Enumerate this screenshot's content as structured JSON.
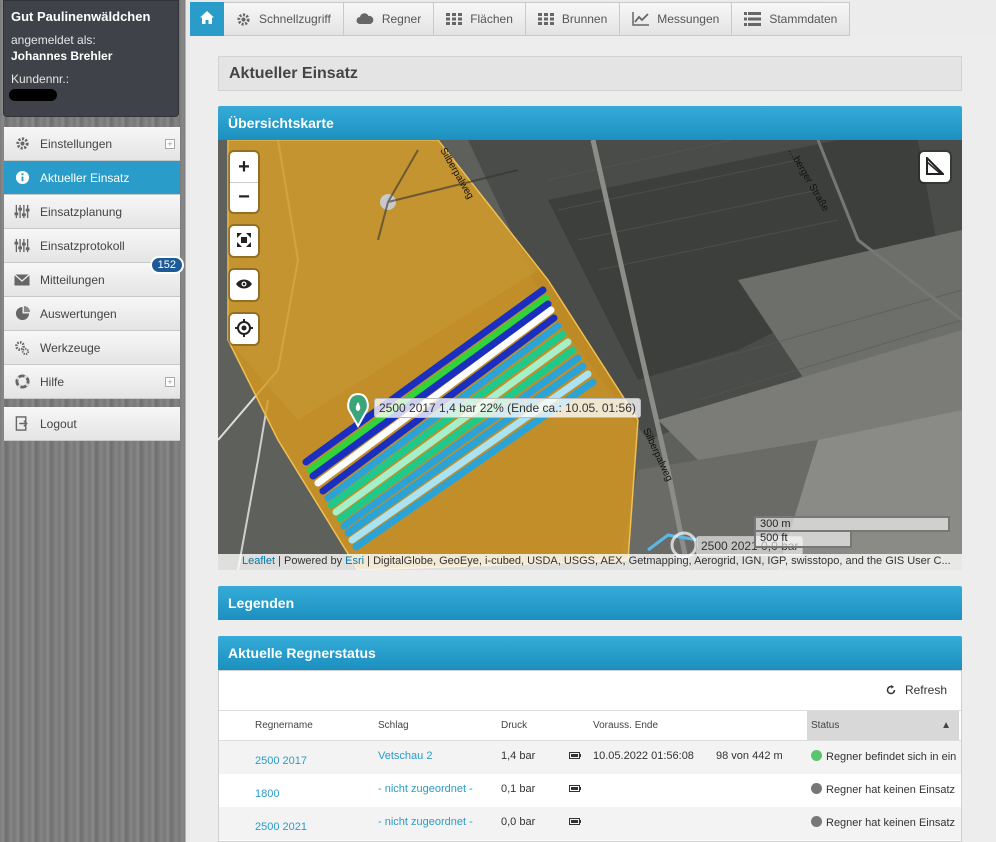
{
  "account": {
    "farm": "Gut Paulinenwäldchen",
    "logged_in_label": "angemeldet als:",
    "user": "Johannes Brehler",
    "customer_label": "Kundennr.:"
  },
  "nav": {
    "items": [
      {
        "label": "Einstellungen",
        "icon": "gear-icon"
      },
      {
        "label": "Aktueller Einsatz",
        "icon": "info-icon"
      },
      {
        "label": "Einsatzplanung",
        "icon": "sliders-icon"
      },
      {
        "label": "Einsatzprotokoll",
        "icon": "sliders-icon"
      },
      {
        "label": "Mitteilungen",
        "icon": "envelope-icon",
        "badge": "152"
      },
      {
        "label": "Auswertungen",
        "icon": "pie-chart-icon"
      },
      {
        "label": "Werkzeuge",
        "icon": "cogs-icon"
      },
      {
        "label": "Hilfe",
        "icon": "lifebuoy-icon"
      }
    ],
    "logout": "Logout"
  },
  "tabs": [
    {
      "label": "Schnellzugriff",
      "icon": "gear-icon"
    },
    {
      "label": "Regner",
      "icon": "cloud-icon"
    },
    {
      "label": "Flächen",
      "icon": "grid-icon"
    },
    {
      "label": "Brunnen",
      "icon": "grid-icon"
    },
    {
      "label": "Messungen",
      "icon": "line-chart-icon"
    },
    {
      "label": "Stammdaten",
      "icon": "list-icon"
    }
  ],
  "page_title": "Aktueller Einsatz",
  "map": {
    "header": "Übersichtskarte",
    "tooltip_main": "2500 2017 1,4 bar 22% (Ende ca.: 10.05. 01:56)",
    "tooltip_second": "2500 2021 0,0 bar",
    "road_label_1": "Silberpalweg",
    "road_label_2": "Silberpalweg",
    "road_label_3": "…berger Straße",
    "scale_m": "300 m",
    "scale_ft": "500 ft",
    "attribution_leaflet": "Leaflet",
    "attribution_powered": " | Powered by ",
    "attribution_esri": "Esri",
    "attribution_rest": " | DigitalGlobe, GeoEye, i-cubed, USDA, USGS, AEX, Getmapping, Aerogrid, IGN, IGP, swisstopo, and the GIS User C..."
  },
  "legend_header": "Legenden",
  "status": {
    "header": "Aktuelle Regnerstatus",
    "refresh": "Refresh",
    "columns": {
      "name": "Regnername",
      "field": "Schlag",
      "pressure": "Druck",
      "end": "Vorauss. Ende",
      "status": "Status",
      "sort_indicator": "▲"
    },
    "rows": [
      {
        "name": "2500 2017",
        "field": "Vetschau 2",
        "pressure": "1,4 bar",
        "end": "10.05.2022 01:56:08",
        "progress": "98 von 442 m",
        "status": "Regner befindet sich in ein",
        "status_color": "#5cc46e"
      },
      {
        "name": "1800",
        "field": "- nicht zugeordnet -",
        "pressure": "0,1 bar",
        "end": "",
        "progress": "",
        "status": "Regner hat keinen Einsatz",
        "status_color": "#777777"
      },
      {
        "name": "2500 2021",
        "field": "- nicht zugeordnet -",
        "pressure": "0,0 bar",
        "end": "",
        "progress": "",
        "status": "Regner hat keinen Einsatz",
        "status_color": "#777777"
      }
    ]
  },
  "colors": {
    "accent": "#2a9cc9",
    "field_overlay": "#d99a1e",
    "badge": "#1c5b96"
  }
}
